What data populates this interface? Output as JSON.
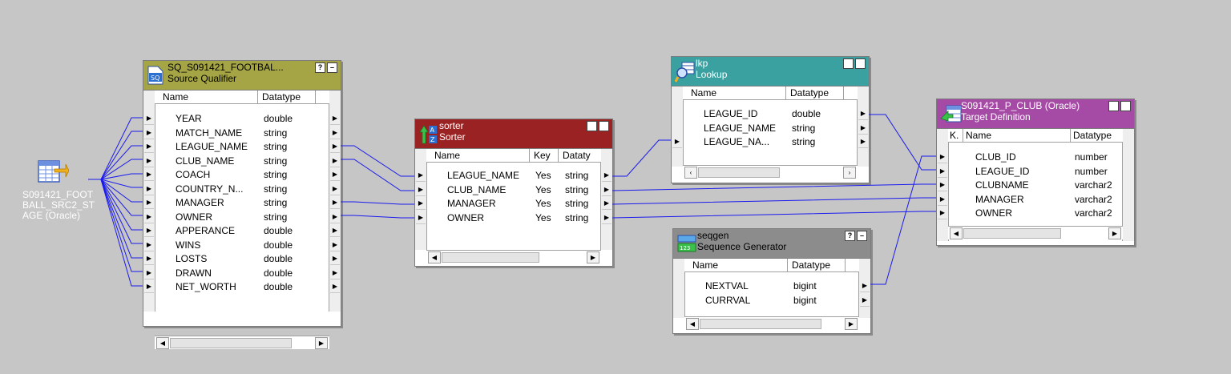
{
  "source": {
    "label": "S091421_FOOT\nBALL_SRC2_ST\nAGE (Oracle)"
  },
  "sq": {
    "title": "SQ_S091421_FOOTBAL...",
    "subtitle": "Source Qualifier",
    "header_color": "#a5a545",
    "columns": [
      "Name",
      "Datatype"
    ],
    "ports": [
      {
        "name": "YEAR",
        "type": "double"
      },
      {
        "name": "MATCH_NAME",
        "type": "string"
      },
      {
        "name": "LEAGUE_NAME",
        "type": "string"
      },
      {
        "name": "CLUB_NAME",
        "type": "string"
      },
      {
        "name": "COACH",
        "type": "string"
      },
      {
        "name": "COUNTRY_N...",
        "type": "string"
      },
      {
        "name": "MANAGER",
        "type": "string"
      },
      {
        "name": "OWNER",
        "type": "string"
      },
      {
        "name": "APPERANCE",
        "type": "double"
      },
      {
        "name": "WINS",
        "type": "double"
      },
      {
        "name": "LOSTS",
        "type": "double"
      },
      {
        "name": "DRAWN",
        "type": "double"
      },
      {
        "name": "NET_WORTH",
        "type": "double"
      }
    ]
  },
  "sorter": {
    "title": "sorter",
    "subtitle": "Sorter",
    "header_color": "#9a2222",
    "columns": [
      "Name",
      "Key",
      "Dataty"
    ],
    "ports": [
      {
        "name": "LEAGUE_NAME",
        "key": "Yes",
        "type": "string"
      },
      {
        "name": "CLUB_NAME",
        "key": "Yes",
        "type": "string"
      },
      {
        "name": "MANAGER",
        "key": "Yes",
        "type": "string"
      },
      {
        "name": "OWNER",
        "key": "Yes",
        "type": "string"
      }
    ]
  },
  "lkp": {
    "title": "lkp",
    "subtitle": "Lookup",
    "header_color": "#3aa0a0",
    "columns": [
      "Name",
      "Datatype"
    ],
    "ports": [
      {
        "name": "LEAGUE_ID",
        "type": "double"
      },
      {
        "name": "LEAGUE_NAME",
        "type": "string"
      },
      {
        "name": "LEAGUE_NA...",
        "type": "string"
      }
    ]
  },
  "seq": {
    "title": "seqgen",
    "subtitle": "Sequence Generator",
    "header_color": "#8c8c8c",
    "columns": [
      "Name",
      "Datatype"
    ],
    "ports": [
      {
        "name": "NEXTVAL",
        "type": "bigint"
      },
      {
        "name": "CURRVAL",
        "type": "bigint"
      }
    ]
  },
  "target": {
    "title": "S091421_P_CLUB (Oracle)",
    "subtitle": "Target Definition",
    "header_color": "#a54aa5",
    "columns": [
      "K.",
      "Name",
      "Datatype"
    ],
    "ports": [
      {
        "name": "CLUB_ID",
        "type": "number"
      },
      {
        "name": "LEAGUE_ID",
        "type": "number"
      },
      {
        "name": "CLUBNAME",
        "type": "varchar2"
      },
      {
        "name": "MANAGER",
        "type": "varchar2"
      },
      {
        "name": "OWNER",
        "type": "varchar2"
      }
    ]
  },
  "buttons": {
    "help": "?",
    "minimize": "–"
  },
  "colors": {
    "canvas": "#c6c6c6",
    "link": "#1a1aee"
  }
}
